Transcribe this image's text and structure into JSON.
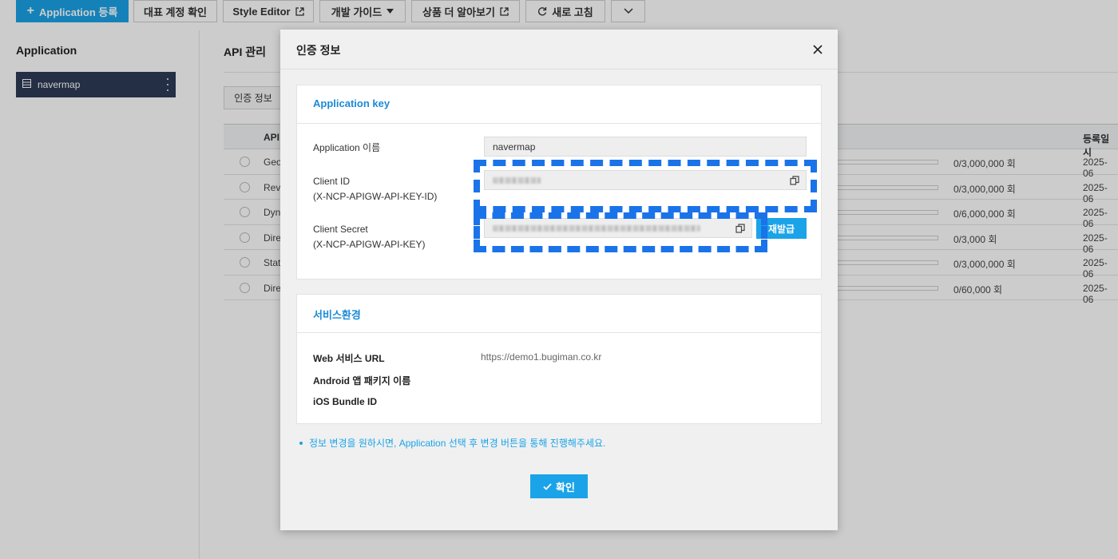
{
  "toolbar": {
    "register_label": "Application 등록",
    "account_label": "대표 계정 확인",
    "style_editor_label": "Style Editor",
    "dev_guide_label": "개발 가이드",
    "more_products_label": "상품 더 알아보기",
    "refresh_label": "새로 고침"
  },
  "sidebar": {
    "title": "Application",
    "app_name": "navermap"
  },
  "main": {
    "title": "API 관리",
    "auth_tab": "인증 정보",
    "table": {
      "columns": [
        "API",
        "등록일시"
      ],
      "rows": [
        {
          "name": "Geo",
          "usage": "0/3,000,000 회",
          "date": "2025-06"
        },
        {
          "name": "Reve",
          "usage": "0/3,000,000 회",
          "date": "2025-06"
        },
        {
          "name": "Dyn",
          "usage": "0/6,000,000 회",
          "date": "2025-06"
        },
        {
          "name": "Dire",
          "usage": "0/3,000 회",
          "date": "2025-06"
        },
        {
          "name": "Stat",
          "usage": "0/3,000,000 회",
          "date": "2025-06"
        },
        {
          "name": "Dire",
          "usage": "0/60,000 회",
          "date": "2025-06"
        }
      ]
    }
  },
  "modal": {
    "title": "인증 정보",
    "app_key_section": {
      "title": "Application key",
      "app_name_label": "Application 이름",
      "app_name_value": "navermap",
      "client_id_label": "Client ID",
      "client_id_sub": "(X-NCP-APIGW-API-KEY-ID)",
      "client_secret_label": "Client Secret",
      "client_secret_sub": "(X-NCP-APIGW-API-KEY)",
      "reissue_label": "재발급"
    },
    "service_section": {
      "title": "서비스환경",
      "web_label": "Web 서비스 URL",
      "web_value": "https://demo1.bugiman.co.kr",
      "android_label": "Android 앱 패키지 이름",
      "ios_label": "iOS Bundle ID"
    },
    "note": "정보 변경을 원하시면, Application 선택 후 변경 버튼을 통해 진행해주세요.",
    "confirm_label": "확인"
  },
  "colors": {
    "accent": "#1aa3e8",
    "sidebar_active": "#2d3a57",
    "highlight_dash": "#1a73e8"
  }
}
